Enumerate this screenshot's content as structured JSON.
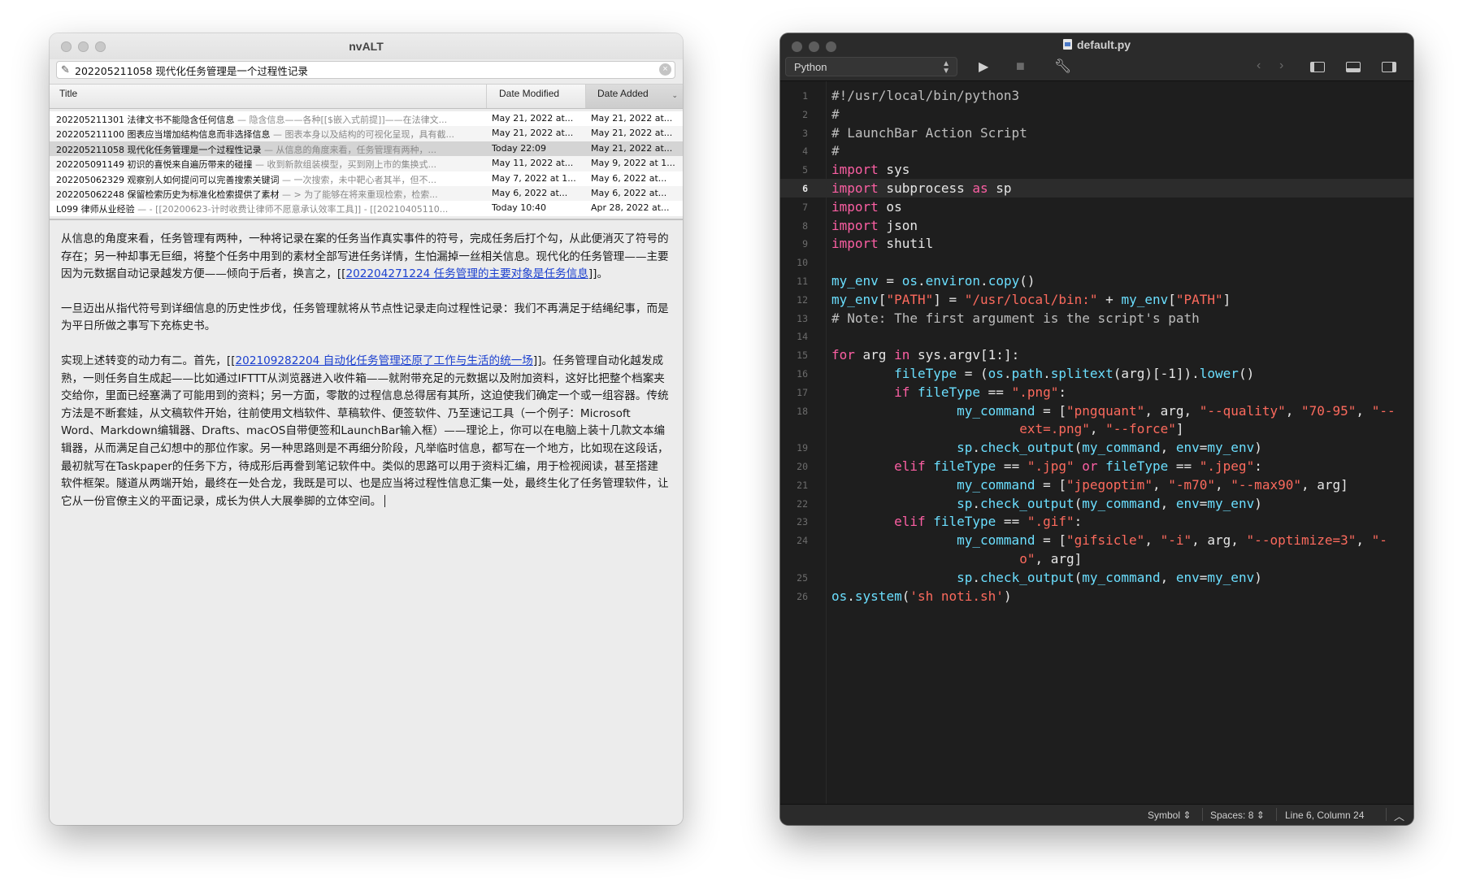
{
  "nvalt": {
    "window_title": "nvALT",
    "search_value": "202205211058 现代化任务管理是一个过程性记录",
    "columns": {
      "title": "Title",
      "date_modified": "Date Modified",
      "date_added": "Date Added"
    },
    "notes": [
      {
        "title": "202205211301 法律文书不能隐含任何信息",
        "snippet": " — 隐含信息——各种[[$嵌入式前提]]——在法律文...",
        "modified": "May 21, 2022 at...",
        "added": "May 21, 2022 at..."
      },
      {
        "title": "202205211100 图表应当增加结构信息而非选择信息",
        "snippet": " — 图表本身以及結构的可视化呈现，具有截...",
        "modified": "May 21, 2022 at...",
        "added": "May 21, 2022 at..."
      },
      {
        "title": "202205211058 现代化任务管理是一个过程性记录",
        "snippet": " — 从信息的角度来看，任务管理有两种，...",
        "modified": "Today 22:09",
        "added": "May 21, 2022 at..."
      },
      {
        "title": "202205091149 初识的喜悦来自遍历带来的碰撞",
        "snippet": " — 收到新款组装模型，买到刚上市的集换式...",
        "modified": "May 11, 2022 at...",
        "added": "May 9, 2022 at 1..."
      },
      {
        "title": "202205062329 观察别人如何提问可以完善搜索关键词",
        "snippet": " — 一次搜索，未中靶心者其半，但不...",
        "modified": "May 7, 2022 at 1...",
        "added": "May 6, 2022 at..."
      },
      {
        "title": "202205062248 保留检索历史为标准化检索提供了素材",
        "snippet": " — > 为了能够在将来重现检索，检索...",
        "modified": "May 6, 2022 at...",
        "added": "May 6, 2022 at..."
      },
      {
        "title": "L099 律师从业经验",
        "snippet": " — - [[20200623-计时收费让律师不愿意承认效率工具]] - [[20210405110...",
        "modified": "Today 10:40",
        "added": "Apr 28, 2022 at..."
      }
    ],
    "body": {
      "p1_a": "从信息的角度来看，任务管理有两种，一种将记录在案的任务当作真实事件的符号，完成任务后打个勾，从此便消灭了符号的存在；另一种却事无巨细，将整个任务中用到的素材全部写进任务详情，生怕漏掉一丝相关信息。现代化的任务管理——主要因为元数据自动记录越发方便——倾向于后者，换言之，[[",
      "p1_link": "202204271224 任务管理的主要对象是任务信息",
      "p1_b": "]]。",
      "p2": "一旦迈出从指代符号到详细信息的历史性步伐，任务管理就将从节点性记录走向过程性记录：我们不再满足于结绳纪事，而是为平日所做之事写下充栋史书。",
      "p3_a": "实现上述转变的动力有二。首先，[[",
      "p3_link": "202109282204 自动化任务管理还原了工作与生活的统一场",
      "p3_b": "]]。任务管理自动化越发成熟，一则任务自生成起——比如通过IFTTT从浏览器进入收件箱——就附带充足的元数据以及附加资料，这好比把整个档案夹交给你，里面已经塞满了可能用到的资料；另一方面，零散的过程信息总得居有其所，这迫使我们确定一个或一组容器。传统方法是不断套娃，从文稿软件开始，往前使用文档软件、草稿软件、便签软件、乃至速记工具（一个例子：Microsoft Word、Markdown编辑器、Drafts、macOS自带便签和LaunchBar输入框）——理论上，你可以在电脑上装十几款文本编辑器，从而满足自己幻想中的那位作家。另一种思路则是不再细分阶段，凡举临时信息，都写在一个地方，比如现在这段话，最初就写在Taskpaper的任务下方，待成形后再誊到笔记软件中。类似的思路可以用于资料汇编，用于检视阅读，甚至搭建软件框架。隧道从两端开始，最终在一处合龙，我既是可以、也是应当将过程性信息汇集一处，最终生化了任务管理软件，让它从一份官僚主义的平面记录，成长为供人大展拳脚的立体空间。"
    }
  },
  "editor": {
    "window_title": "default.py",
    "language": "Python",
    "current_line": 6,
    "lines": [
      {
        "n": "1",
        "t": [
          [
            "cm",
            "#!/usr/local/bin/python3"
          ]
        ]
      },
      {
        "n": "2",
        "t": [
          [
            "cm",
            "#"
          ]
        ]
      },
      {
        "n": "3",
        "t": [
          [
            "cm",
            "# LaunchBar Action Script"
          ]
        ]
      },
      {
        "n": "4",
        "t": [
          [
            "cm",
            "#"
          ]
        ]
      },
      {
        "n": "5",
        "t": [
          [
            "kw",
            "import"
          ],
          [
            "pl",
            " sys"
          ]
        ]
      },
      {
        "n": "6",
        "t": [
          [
            "kw",
            "import"
          ],
          [
            "pl",
            " subprocess "
          ],
          [
            "kw",
            "as"
          ],
          [
            "pl",
            " sp"
          ]
        ]
      },
      {
        "n": "7",
        "t": [
          [
            "kw",
            "import"
          ],
          [
            "pl",
            " os"
          ]
        ]
      },
      {
        "n": "8",
        "t": [
          [
            "kw",
            "import"
          ],
          [
            "pl",
            " json"
          ]
        ]
      },
      {
        "n": "9",
        "t": [
          [
            "kw",
            "import"
          ],
          [
            "pl",
            " shutil"
          ]
        ]
      },
      {
        "n": "10",
        "t": []
      },
      {
        "n": "11",
        "t": [
          [
            "fn",
            "my_env"
          ],
          [
            "pl",
            " = "
          ],
          [
            "fn",
            "os"
          ],
          [
            "pl",
            "."
          ],
          [
            "fn",
            "environ"
          ],
          [
            "pl",
            "."
          ],
          [
            "fn",
            "copy"
          ],
          [
            "pl",
            "()"
          ]
        ]
      },
      {
        "n": "12",
        "t": [
          [
            "fn",
            "my_env"
          ],
          [
            "pl",
            "["
          ],
          [
            "st",
            "\"PATH\""
          ],
          [
            "pl",
            "] = "
          ],
          [
            "st",
            "\"/usr/local/bin:\""
          ],
          [
            "pl",
            " + "
          ],
          [
            "fn",
            "my_env"
          ],
          [
            "pl",
            "["
          ],
          [
            "st",
            "\"PATH\""
          ],
          [
            "pl",
            "]"
          ]
        ]
      },
      {
        "n": "13",
        "t": [
          [
            "cm",
            "# Note: The first argument is the script's path"
          ]
        ]
      },
      {
        "n": "14",
        "t": []
      },
      {
        "n": "15",
        "t": [
          [
            "kw",
            "for"
          ],
          [
            "pl",
            " arg "
          ],
          [
            "kw",
            "in"
          ],
          [
            "pl",
            " sys.argv[1:]:"
          ]
        ]
      },
      {
        "n": "16",
        "t": [
          [
            "pl",
            "        "
          ],
          [
            "fn",
            "fileType"
          ],
          [
            "pl",
            " = ("
          ],
          [
            "fn",
            "os"
          ],
          [
            "pl",
            "."
          ],
          [
            "fn",
            "path"
          ],
          [
            "pl",
            "."
          ],
          [
            "fn",
            "splitext"
          ],
          [
            "pl",
            "(arg)[-1])."
          ],
          [
            "fn",
            "lower"
          ],
          [
            "pl",
            "()"
          ]
        ]
      },
      {
        "n": "17",
        "t": [
          [
            "pl",
            "        "
          ],
          [
            "kw",
            "if"
          ],
          [
            "pl",
            " "
          ],
          [
            "fn",
            "fileType"
          ],
          [
            "pl",
            " == "
          ],
          [
            "st",
            "\".png\""
          ],
          [
            "pl",
            ":"
          ]
        ]
      },
      {
        "n": "18",
        "t": [
          [
            "pl",
            "                "
          ],
          [
            "fn",
            "my_command"
          ],
          [
            "pl",
            " = ["
          ],
          [
            "st",
            "\"pngquant\""
          ],
          [
            "pl",
            ", arg, "
          ],
          [
            "st",
            "\"--quality\""
          ],
          [
            "pl",
            ", "
          ],
          [
            "st",
            "\"70-95\""
          ],
          [
            "pl",
            ", "
          ],
          [
            "st",
            "\"--"
          ]
        ]
      },
      {
        "n": "",
        "t": [
          [
            "st",
            "                        ext=.png\""
          ],
          [
            "pl",
            ", "
          ],
          [
            "st",
            "\"--force\""
          ],
          [
            "pl",
            "]"
          ]
        ]
      },
      {
        "n": "19",
        "t": [
          [
            "pl",
            "                "
          ],
          [
            "fn",
            "sp"
          ],
          [
            "pl",
            "."
          ],
          [
            "fn",
            "check_output"
          ],
          [
            "pl",
            "("
          ],
          [
            "fn",
            "my_command"
          ],
          [
            "pl",
            ", "
          ],
          [
            "fn",
            "env"
          ],
          [
            "pl",
            "="
          ],
          [
            "fn",
            "my_env"
          ],
          [
            "pl",
            ")"
          ]
        ]
      },
      {
        "n": "20",
        "t": [
          [
            "pl",
            "        "
          ],
          [
            "kw",
            "elif"
          ],
          [
            "pl",
            " "
          ],
          [
            "fn",
            "fileType"
          ],
          [
            "pl",
            " == "
          ],
          [
            "st",
            "\".jpg\""
          ],
          [
            "pl",
            " "
          ],
          [
            "kw",
            "or"
          ],
          [
            "pl",
            " "
          ],
          [
            "fn",
            "fileType"
          ],
          [
            "pl",
            " == "
          ],
          [
            "st",
            "\".jpeg\""
          ],
          [
            "pl",
            ":"
          ]
        ]
      },
      {
        "n": "21",
        "t": [
          [
            "pl",
            "                "
          ],
          [
            "fn",
            "my_command"
          ],
          [
            "pl",
            " = ["
          ],
          [
            "st",
            "\"jpegoptim\""
          ],
          [
            "pl",
            ", "
          ],
          [
            "st",
            "\"-m70\""
          ],
          [
            "pl",
            ", "
          ],
          [
            "st",
            "\"--max90\""
          ],
          [
            "pl",
            ", arg]"
          ]
        ]
      },
      {
        "n": "22",
        "t": [
          [
            "pl",
            "                "
          ],
          [
            "fn",
            "sp"
          ],
          [
            "pl",
            "."
          ],
          [
            "fn",
            "check_output"
          ],
          [
            "pl",
            "("
          ],
          [
            "fn",
            "my_command"
          ],
          [
            "pl",
            ", "
          ],
          [
            "fn",
            "env"
          ],
          [
            "pl",
            "="
          ],
          [
            "fn",
            "my_env"
          ],
          [
            "pl",
            ")"
          ]
        ]
      },
      {
        "n": "23",
        "t": [
          [
            "pl",
            "        "
          ],
          [
            "kw",
            "elif"
          ],
          [
            "pl",
            " "
          ],
          [
            "fn",
            "fileType"
          ],
          [
            "pl",
            " == "
          ],
          [
            "st",
            "\".gif\""
          ],
          [
            "pl",
            ":"
          ]
        ]
      },
      {
        "n": "24",
        "t": [
          [
            "pl",
            "                "
          ],
          [
            "fn",
            "my_command"
          ],
          [
            "pl",
            " = ["
          ],
          [
            "st",
            "\"gifsicle\""
          ],
          [
            "pl",
            ", "
          ],
          [
            "st",
            "\"-i\""
          ],
          [
            "pl",
            ", arg, "
          ],
          [
            "st",
            "\"--optimize=3\""
          ],
          [
            "pl",
            ", "
          ],
          [
            "st",
            "\"-"
          ]
        ]
      },
      {
        "n": "",
        "t": [
          [
            "st",
            "                        o\""
          ],
          [
            "pl",
            ", arg]"
          ]
        ]
      },
      {
        "n": "25",
        "t": [
          [
            "pl",
            "                "
          ],
          [
            "fn",
            "sp"
          ],
          [
            "pl",
            "."
          ],
          [
            "fn",
            "check_output"
          ],
          [
            "pl",
            "("
          ],
          [
            "fn",
            "my_command"
          ],
          [
            "pl",
            ", "
          ],
          [
            "fn",
            "env"
          ],
          [
            "pl",
            "="
          ],
          [
            "fn",
            "my_env"
          ],
          [
            "pl",
            ")"
          ]
        ]
      },
      {
        "n": "26",
        "t": [
          [
            "fn",
            "os"
          ],
          [
            "pl",
            "."
          ],
          [
            "fn",
            "system"
          ],
          [
            "pl",
            "("
          ],
          [
            "st",
            "'sh noti.sh'"
          ],
          [
            "pl",
            ")"
          ]
        ]
      }
    ],
    "status": {
      "symbol": "Symbol",
      "spaces": "Spaces: 8",
      "position": "Line 6, Column 24"
    },
    "colors": {
      "keyword": "#fc5fa3",
      "identifier": "#6bdfff",
      "string": "#fc6a5d",
      "comment": "#bdbdbd",
      "background": "#1e1e1e"
    }
  }
}
